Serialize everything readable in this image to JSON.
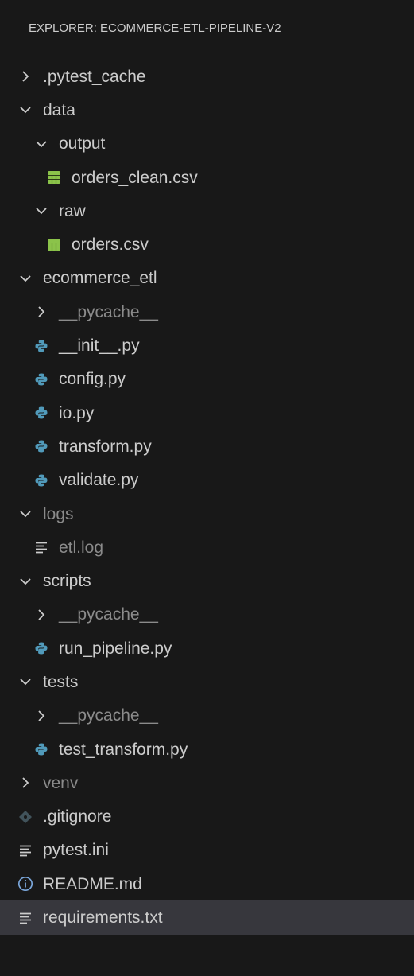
{
  "explorer": {
    "title": "EXPLORER: ECOMMERCE-ETL-PIPELINE-V2"
  },
  "colors": {
    "background": "#181818",
    "text": "#cccccc",
    "dim_text": "#8b8b8b",
    "selected_row": "#37373d",
    "csv_icon": "#8bc34a",
    "python_icon": "#519aba",
    "info_icon": "#7aa6da",
    "git_icon": "#41535b"
  },
  "tree": [
    {
      "label": ".pytest_cache",
      "depth": 0,
      "kind": "folder",
      "expanded": false,
      "dim": false,
      "icon": "chevron-right-icon"
    },
    {
      "label": "data",
      "depth": 0,
      "kind": "folder",
      "expanded": true,
      "dim": false,
      "icon": "chevron-down-icon"
    },
    {
      "label": "output",
      "depth": 1,
      "kind": "folder",
      "expanded": true,
      "dim": false,
      "icon": "chevron-down-icon"
    },
    {
      "label": "orders_clean.csv",
      "depth": 2,
      "kind": "file",
      "dim": false,
      "icon": "csv-file-icon"
    },
    {
      "label": "raw",
      "depth": 1,
      "kind": "folder",
      "expanded": true,
      "dim": false,
      "icon": "chevron-down-icon"
    },
    {
      "label": "orders.csv",
      "depth": 2,
      "kind": "file",
      "dim": false,
      "icon": "csv-file-icon"
    },
    {
      "label": "ecommerce_etl",
      "depth": 0,
      "kind": "folder",
      "expanded": true,
      "dim": false,
      "icon": "chevron-down-icon"
    },
    {
      "label": "__pycache__",
      "depth": 1,
      "kind": "folder",
      "expanded": false,
      "dim": true,
      "icon": "chevron-right-icon"
    },
    {
      "label": "__init__.py",
      "depth": 1,
      "kind": "file",
      "dim": false,
      "icon": "python-file-icon"
    },
    {
      "label": "config.py",
      "depth": 1,
      "kind": "file",
      "dim": false,
      "icon": "python-file-icon"
    },
    {
      "label": "io.py",
      "depth": 1,
      "kind": "file",
      "dim": false,
      "icon": "python-file-icon"
    },
    {
      "label": "transform.py",
      "depth": 1,
      "kind": "file",
      "dim": false,
      "icon": "python-file-icon"
    },
    {
      "label": "validate.py",
      "depth": 1,
      "kind": "file",
      "dim": false,
      "icon": "python-file-icon"
    },
    {
      "label": "logs",
      "depth": 0,
      "kind": "folder",
      "expanded": true,
      "dim": true,
      "icon": "chevron-down-icon"
    },
    {
      "label": "etl.log",
      "depth": 1,
      "kind": "file",
      "dim": true,
      "icon": "text-file-icon"
    },
    {
      "label": "scripts",
      "depth": 0,
      "kind": "folder",
      "expanded": true,
      "dim": false,
      "icon": "chevron-down-icon"
    },
    {
      "label": "__pycache__",
      "depth": 1,
      "kind": "folder",
      "expanded": false,
      "dim": true,
      "icon": "chevron-right-icon"
    },
    {
      "label": "run_pipeline.py",
      "depth": 1,
      "kind": "file",
      "dim": false,
      "icon": "python-file-icon"
    },
    {
      "label": "tests",
      "depth": 0,
      "kind": "folder",
      "expanded": true,
      "dim": false,
      "icon": "chevron-down-icon"
    },
    {
      "label": "__pycache__",
      "depth": 1,
      "kind": "folder",
      "expanded": false,
      "dim": true,
      "icon": "chevron-right-icon"
    },
    {
      "label": "test_transform.py",
      "depth": 1,
      "kind": "file",
      "dim": false,
      "icon": "python-file-icon"
    },
    {
      "label": "venv",
      "depth": 0,
      "kind": "folder",
      "expanded": false,
      "dim": true,
      "icon": "chevron-right-icon"
    },
    {
      "label": ".gitignore",
      "depth": 0,
      "kind": "file",
      "dim": false,
      "icon": "git-file-icon"
    },
    {
      "label": "pytest.ini",
      "depth": 0,
      "kind": "file",
      "dim": false,
      "icon": "text-file-icon"
    },
    {
      "label": "README.md",
      "depth": 0,
      "kind": "file",
      "dim": false,
      "icon": "info-icon"
    },
    {
      "label": "requirements.txt",
      "depth": 0,
      "kind": "file",
      "dim": false,
      "icon": "text-file-icon",
      "selected": true
    }
  ]
}
